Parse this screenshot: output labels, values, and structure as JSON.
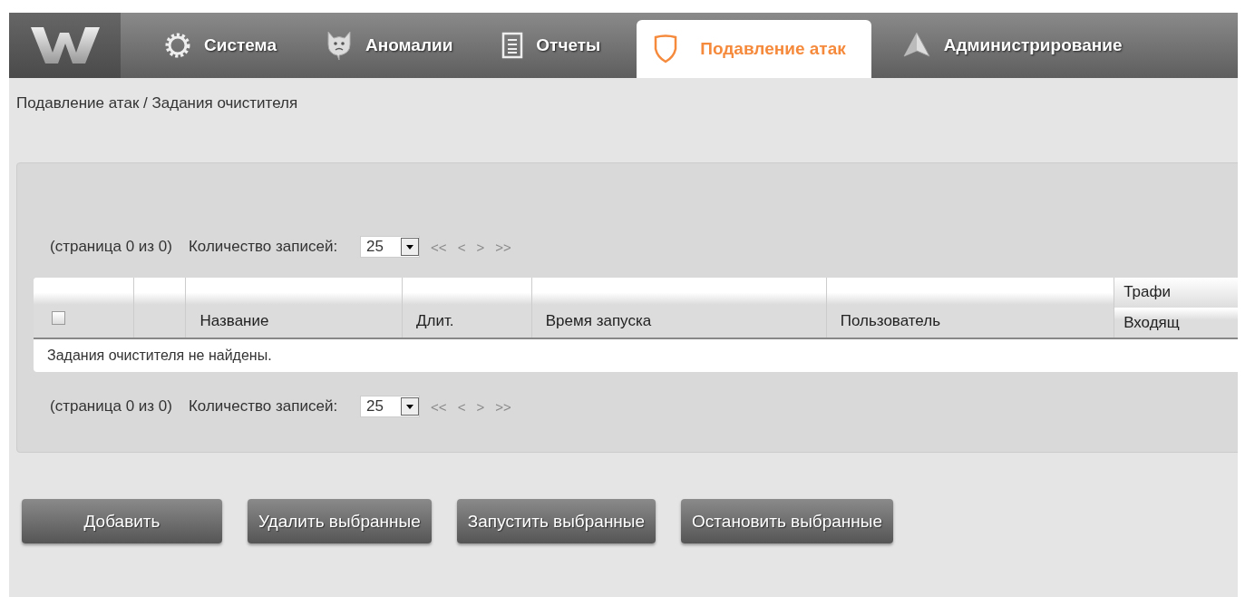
{
  "nav": {
    "tabs": [
      {
        "label": "Система",
        "kind": "gear",
        "selected": false
      },
      {
        "label": "Аномалии",
        "kind": "devil",
        "selected": false
      },
      {
        "label": "Отчеты",
        "kind": "document",
        "selected": false
      },
      {
        "label": "Подавление атак",
        "kind": "shield",
        "selected": true
      },
      {
        "label": "Администрирование",
        "kind": "arrow",
        "selected": false
      }
    ]
  },
  "breadcrumb": "Подавление атак / Задания очистителя",
  "pager_top": {
    "page_info": "(страница 0 из 0)",
    "count_label": "Количество записей:",
    "count_value": "25",
    "links": [
      "<<",
      "<",
      ">",
      ">>"
    ]
  },
  "table": {
    "select_all_checked": false,
    "columns": [
      {},
      {
        "label": "Название"
      },
      {
        "label": "Длит."
      },
      {
        "label": "Время запуска"
      },
      {
        "label": "Пользователь"
      },
      {
        "group": "Трафи",
        "label": "Входящ"
      }
    ],
    "empty_message": "Задания очистителя не найдены."
  },
  "pager_bottom": {
    "page_info": "(страница 0 из 0)",
    "count_label": "Количество записей:",
    "count_value": "25",
    "links": [
      "<<",
      "<",
      ">",
      ">>"
    ]
  },
  "buttons": [
    "Добавить",
    "Удалить выбранные",
    "Запустить выбранные",
    "Остановить выбранные"
  ]
}
